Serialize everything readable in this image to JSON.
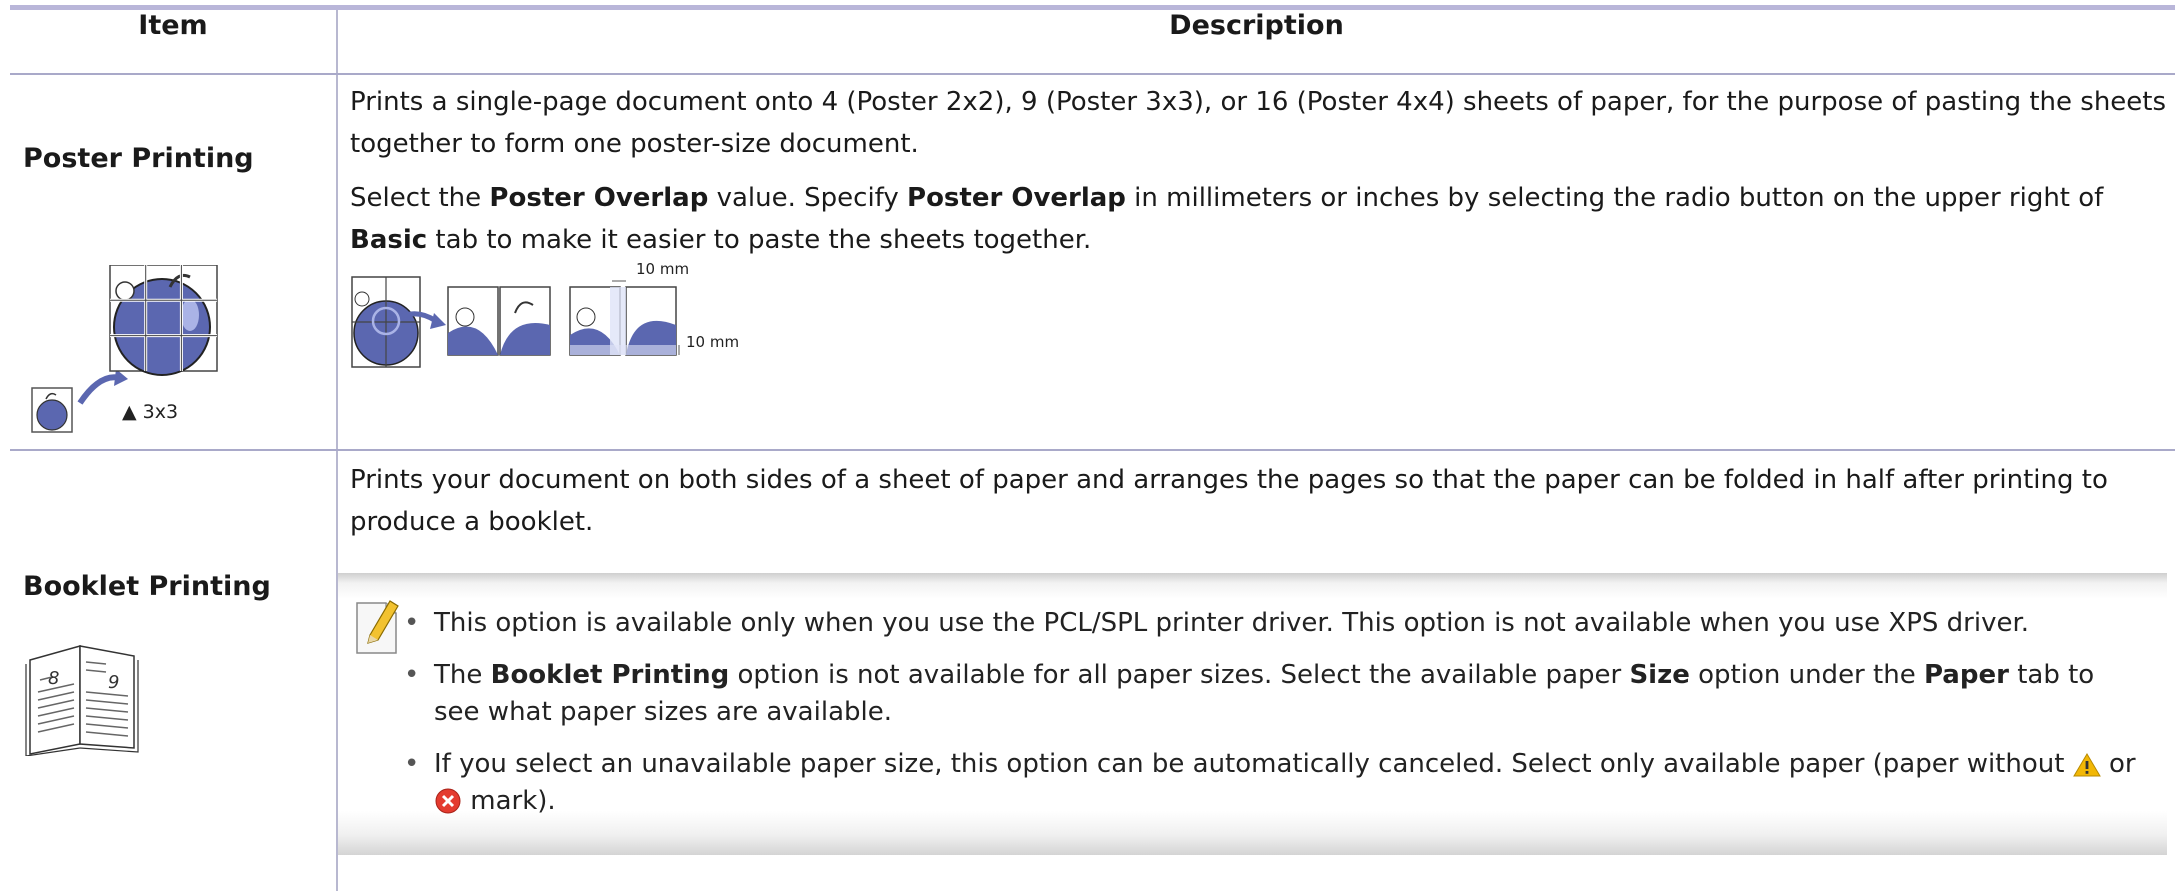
{
  "table": {
    "header_item": "Item",
    "header_description": "Description"
  },
  "poster": {
    "title": "Poster Printing",
    "layout_label": "▲ 3x3",
    "description_1": "Prints a single-page document onto 4 (Poster 2x2), 9 (Poster 3x3), or 16 (Poster 4x4) sheets of paper, for the purpose of pasting the sheets together to form one poster-size document.",
    "description_2": {
      "t1": "Select the ",
      "b1": "Poster Overlap",
      "t2": " value. Specify ",
      "b2": "Poster Overlap",
      "t3": " in millimeters or inches by selecting the radio button on the upper right of ",
      "b3": "Basic",
      "t4": " tab to make it easier to paste the sheets together."
    },
    "overlap_label_top": "10 mm",
    "overlap_label_side": "10 mm"
  },
  "booklet": {
    "title": "Booklet Printing",
    "page_left": "8",
    "page_right": "9",
    "description": "Prints your document on both sides of a sheet of paper and arranges the pages so that the paper can be folded in half after printing to produce a booklet.",
    "notes": {
      "n1": "This option is available only when you use the PCL/SPL printer driver. This option is not available when you use XPS driver.",
      "n2": {
        "t1": "The ",
        "b1": "Booklet Printing",
        "t2": " option is not available for all paper sizes. Select the available paper ",
        "b2": "Size",
        "t3": " option under the ",
        "b3": "Paper",
        "t4": " tab to see what paper sizes are available."
      },
      "n3": {
        "t1": "If you select an unavailable paper size, this option can be automatically canceled. Select only available paper (paper without ",
        "t2": " or ",
        "t3": " mark)."
      }
    }
  },
  "colors": {
    "apple_blue": "#5b67b0",
    "header_rule": "#b9b6d9",
    "warning_yellow": "#f2b705",
    "error_red": "#e43b2f"
  }
}
